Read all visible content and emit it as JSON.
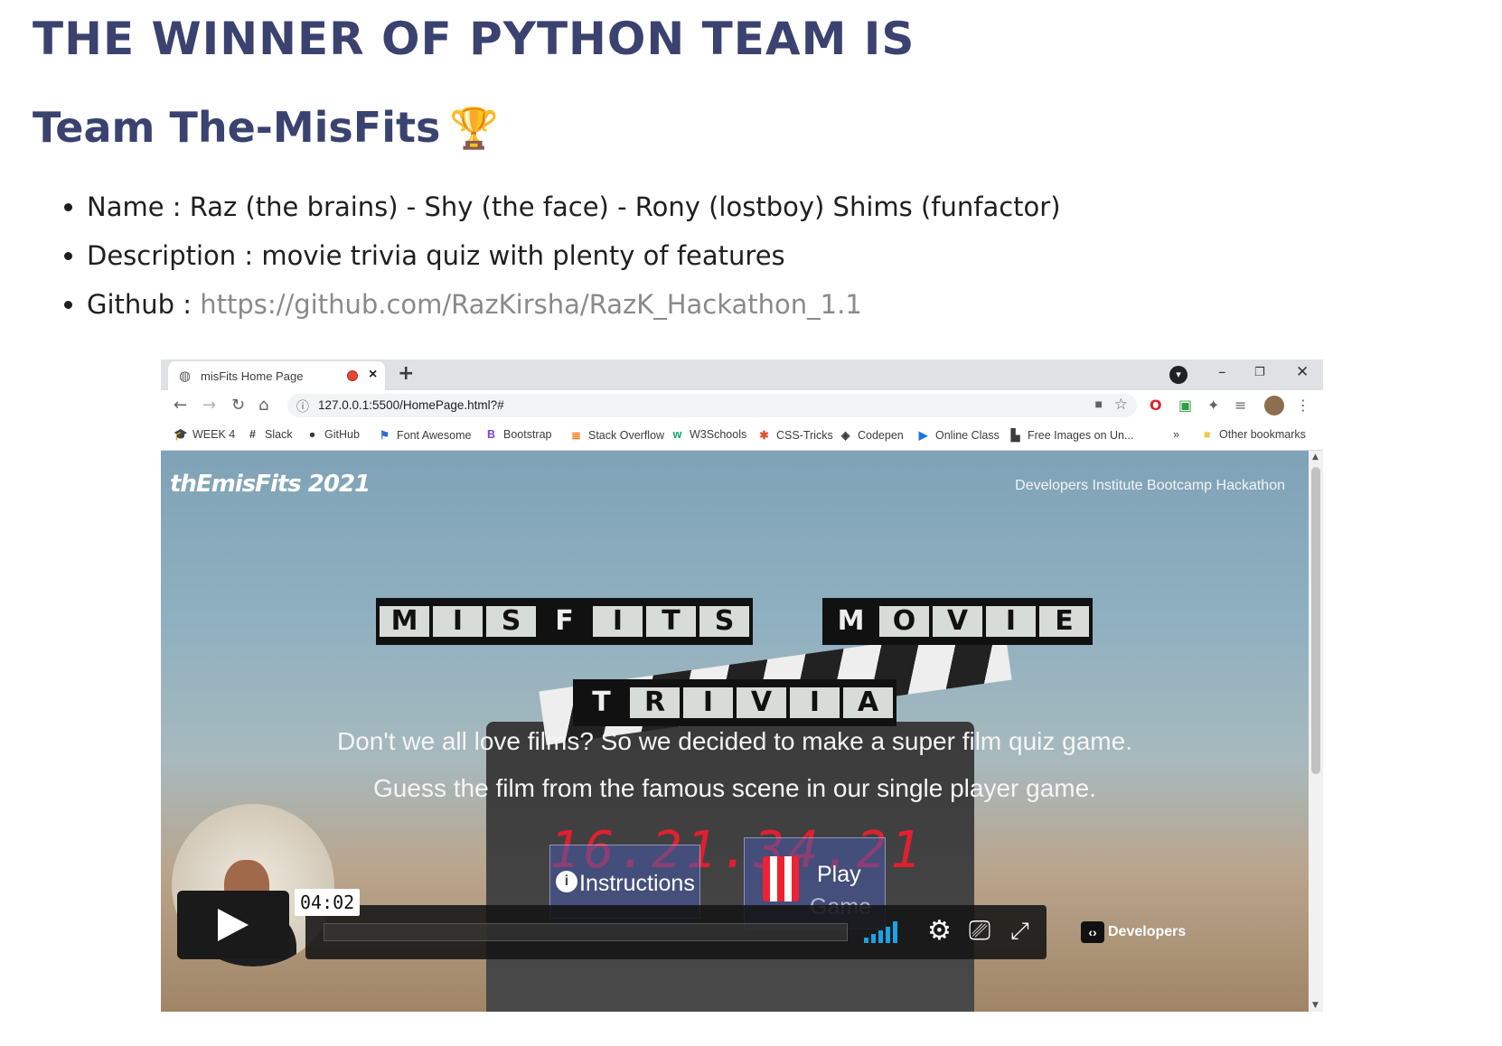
{
  "heading": "THE WINNER OF PYTHON TEAM IS",
  "subheading": "Team The-MisFits",
  "trophy_icon": "🏆",
  "facts": {
    "name": "Name : Raz (the brains) - Shy (the face) - Rony (lostboy) Shims (funfactor)",
    "description": "Description : movie trivia quiz with plenty of features",
    "github_label": "Github : ",
    "github_url": "https://github.com/RazKirsha/RazK_Hackathon_1.1"
  },
  "browser": {
    "tab_title": "misFits Home Page",
    "url": "127.0.0.1:5500/HomePage.html?#",
    "bookmarks": [
      "WEEK 4",
      "Slack",
      "GitHub",
      "Font Awesome",
      "Bootstrap",
      "Stack Overflow",
      "W3Schools",
      "CSS-Tricks",
      "Codepen",
      "Online Class",
      "Free Images on Un...",
      "»",
      "Other bookmarks"
    ]
  },
  "site": {
    "logo": "thEmisFits 2021",
    "tagline": "Developers Institute Bootcamp Hackathon",
    "title_words": [
      [
        "M",
        "I",
        "S",
        "F",
        "I",
        "T",
        "S"
      ],
      [
        "M",
        "O",
        "V",
        "I",
        "E"
      ],
      [
        "T",
        "R",
        "I",
        "V",
        "I",
        "A"
      ]
    ],
    "line1": "Don't we all love films? So we decided to make a super film quiz game.",
    "line2": "Guess the film from the famous scene in our single player game.",
    "timecode": "16.21.34.21",
    "instructions_label": "Instructions",
    "play_label": "Play",
    "play_label2": "Game"
  },
  "player": {
    "time": "04:02",
    "brand": "Developers"
  }
}
